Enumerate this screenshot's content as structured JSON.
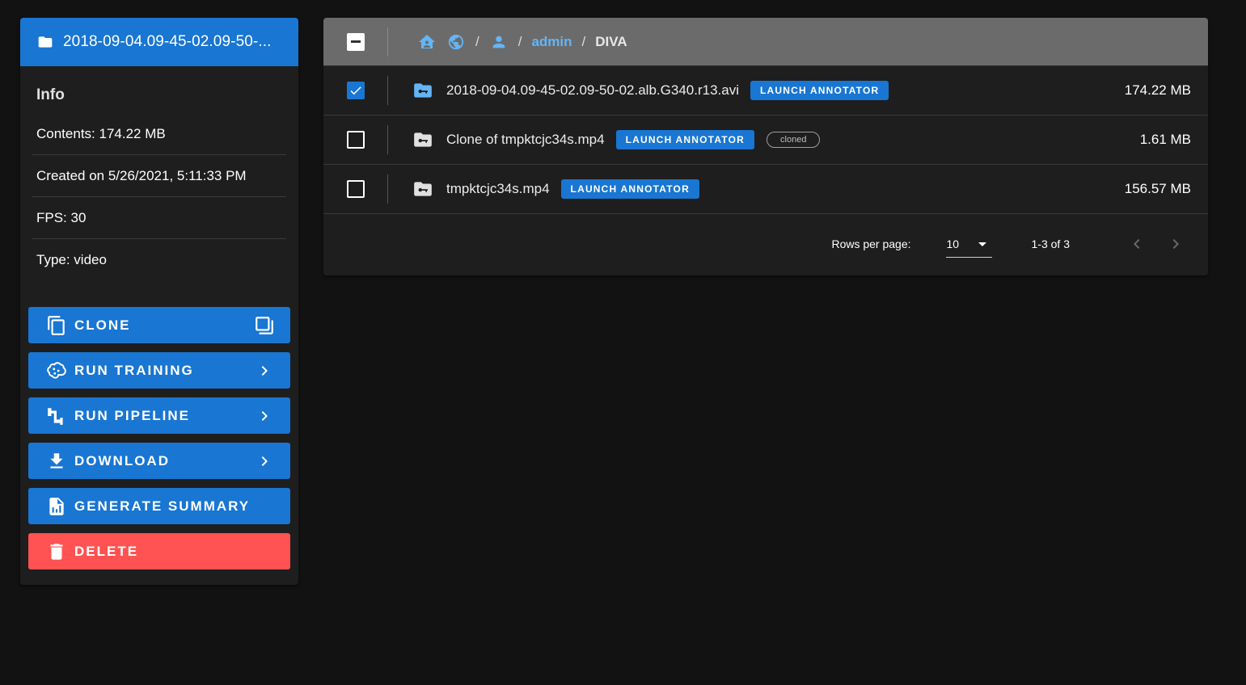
{
  "sidebar": {
    "title": "2018-09-04.09-45-02.09-50-...",
    "info_heading": "Info",
    "info_rows": [
      "Contents: 174.22 MB",
      "Created on 5/26/2021, 5:11:33 PM",
      "FPS: 30",
      "Type: video"
    ],
    "actions": [
      {
        "label": "CLONE",
        "icon": "content-copy-icon",
        "trailing_icon": "library-icon"
      },
      {
        "label": "RUN TRAINING",
        "icon": "brain-icon",
        "trailing_icon": "chevron-right-icon"
      },
      {
        "label": "RUN PIPELINE",
        "icon": "pipe-icon",
        "trailing_icon": "chevron-right-icon"
      },
      {
        "label": "DOWNLOAD",
        "icon": "download-icon",
        "trailing_icon": "chevron-right-icon"
      },
      {
        "label": "GENERATE SUMMARY",
        "icon": "file-chart-icon",
        "trailing_icon": ""
      },
      {
        "label": "DELETE",
        "icon": "trash-icon",
        "trailing_icon": ""
      }
    ],
    "colors": {
      "primary": "#1976d2",
      "danger": "#ff5252"
    }
  },
  "breadcrumb": {
    "icons": [
      "home-account-icon",
      "globe-icon",
      "account-icon"
    ],
    "separator": "/",
    "link": "admin",
    "current": "DIVA"
  },
  "rows": [
    {
      "name": "2018-09-04.09-45-02.09-50-02.alb.G340.r13.avi",
      "button": "LAUNCH ANNOTATOR",
      "chip": "",
      "size": "174.22 MB",
      "checked": true
    },
    {
      "name": "Clone of tmpktcjc34s.mp4",
      "button": "LAUNCH ANNOTATOR",
      "chip": "cloned",
      "size": "1.61 MB",
      "checked": false
    },
    {
      "name": "tmpktcjc34s.mp4",
      "button": "LAUNCH ANNOTATOR",
      "chip": "",
      "size": "156.57 MB",
      "checked": false
    }
  ],
  "pagination": {
    "rows_per_page_label": "Rows per page:",
    "rows_per_page_value": "10",
    "range": "1-3 of 3"
  }
}
